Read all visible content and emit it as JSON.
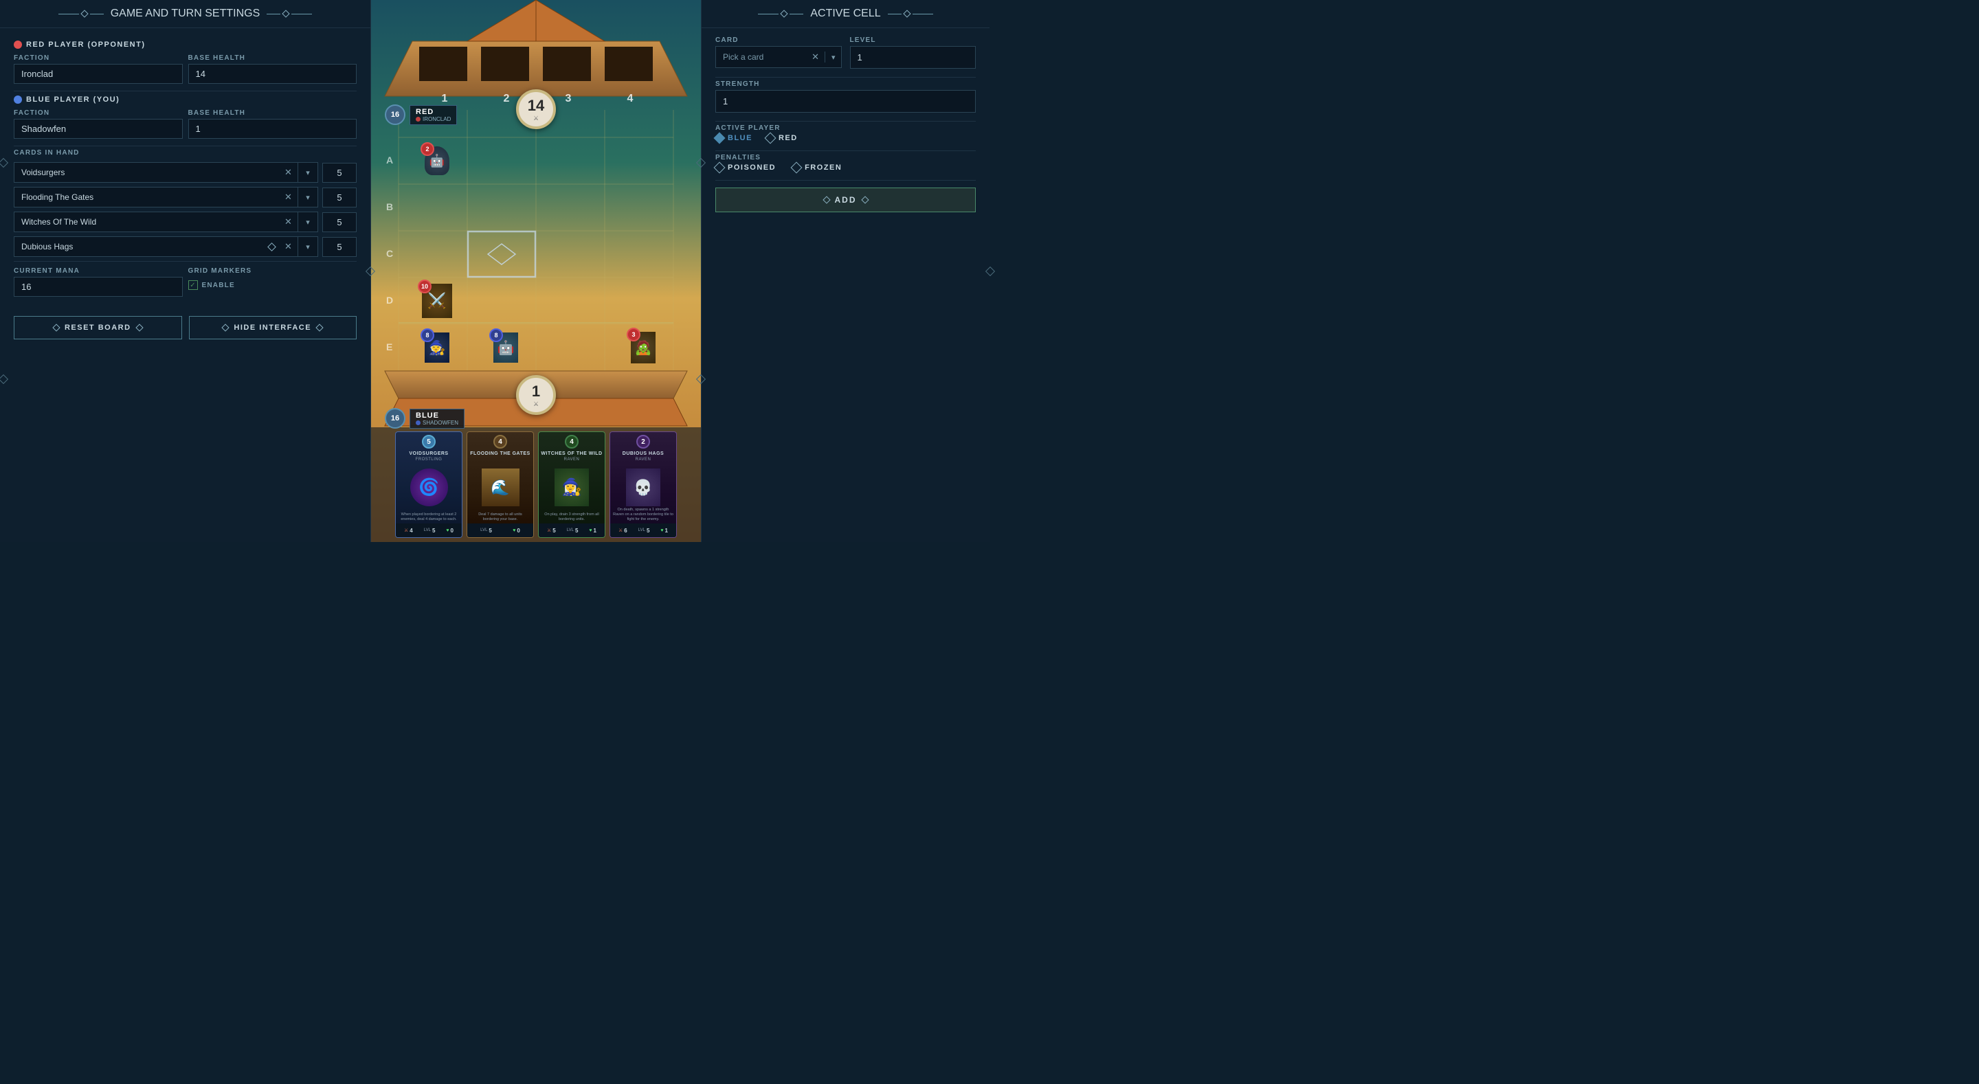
{
  "left_panel": {
    "header_title": "GAME AND TURN SETTINGS",
    "red_player_label": "RED PLAYER (OPPONENT)",
    "blue_player_label": "BLUE PLAYER (YOU)",
    "faction_label": "FACTION",
    "base_health_label": "BASE HEALTH",
    "red_faction": "Ironclad",
    "red_health": "14",
    "blue_faction": "Shadowfen",
    "blue_health": "1",
    "cards_in_hand_label": "CARDS IN HAND",
    "cards": [
      {
        "name": "Voidsurgers",
        "count": "5"
      },
      {
        "name": "Flooding The Gates",
        "count": "5"
      },
      {
        "name": "Witches Of The Wild",
        "count": "5"
      },
      {
        "name": "Dubious Hags",
        "count": "5"
      }
    ],
    "current_mana_label": "CURRENT MANA",
    "current_mana": "16",
    "grid_markers_label": "GRID MARKERS",
    "enable_label": "ENABLE",
    "reset_board_label": "RESET BOARD",
    "hide_interface_label": "HIDE INTERFACE"
  },
  "center_panel": {
    "red_player_name": "RED",
    "red_faction_name": "IRONCLAD",
    "red_level": "16",
    "red_health": "14",
    "blue_player_name": "BLUE",
    "blue_faction_name": "SHADOWFEN",
    "blue_level": "16",
    "blue_health": "1",
    "row_labels": [
      "A",
      "B",
      "C",
      "D",
      "E"
    ],
    "col_numbers": [
      "1",
      "2",
      "3",
      "4"
    ],
    "hand_cards": [
      {
        "name": "VOIDSURGERS",
        "subfaction": "FROSTLING",
        "cost": "5",
        "desc": "When played bordering at least 2 enemies, deal 4 damage to each.",
        "attack": "4",
        "level": "5",
        "health": "0"
      },
      {
        "name": "FLOODING THE GATES",
        "subfaction": "",
        "cost": "4",
        "desc": "Deal 7 damage to all units bordering your base.",
        "attack": "",
        "level": "5",
        "health": "0"
      },
      {
        "name": "WITCHES OF THE WILD",
        "subfaction": "RAVEN",
        "cost": "4",
        "desc": "On play, drain 3 strength from all bordering units.",
        "attack": "5",
        "level": "5",
        "health": "1"
      },
      {
        "name": "DUBIOUS HAGS",
        "subfaction": "RAVEN",
        "cost": "2",
        "desc": "On death, spawns a 1 strength Raven on a random bordering tile to fight for the enemy.",
        "attack": "6",
        "level": "5",
        "health": "1"
      }
    ]
  },
  "right_panel": {
    "header_title": "ACTIVE CELL",
    "card_label": "CARD",
    "level_label": "LEVEL",
    "pick_card_placeholder": "Pick a card",
    "level_value": "1",
    "strength_label": "STRENGTH",
    "strength_value": "1",
    "active_player_label": "ACTIVE PLAYER",
    "blue_label": "BLUE",
    "red_label": "RED",
    "penalties_label": "PENALTIES",
    "poisoned_label": "POISONED",
    "frozen_label": "FROZEN",
    "add_label": "ADD"
  },
  "icons": {
    "arrow_right": "→",
    "arrow_left": "←",
    "close": "✕",
    "chevron_down": "▾",
    "check": "✓",
    "diamond": "◇",
    "diamond_filled": "◆"
  }
}
